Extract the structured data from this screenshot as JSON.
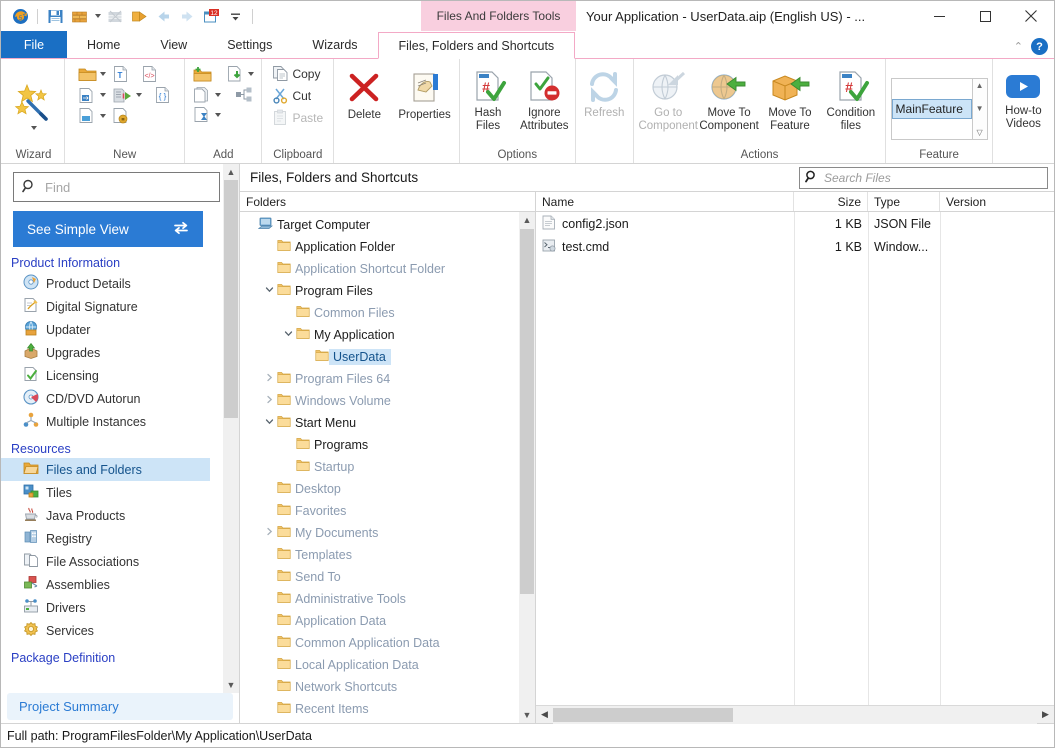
{
  "window": {
    "title": "Your Application - UserData.aip (English US) - ...",
    "contextual_tab_group": "Files And Folders Tools",
    "minimize": "─",
    "maximize": "☐",
    "close": "✕",
    "collapse_ribbon": "⌃",
    "help": "?"
  },
  "quick_access": {
    "items": [
      {
        "name": "app-icon"
      },
      {
        "name": "save-icon"
      },
      {
        "name": "build-icon"
      },
      {
        "name": "build-dropdown-caret"
      },
      {
        "name": "build-all-icon"
      },
      {
        "name": "run-icon"
      },
      {
        "name": "back-arrow-icon"
      },
      {
        "name": "forward-arrow-icon"
      },
      {
        "name": "trial-days-icon",
        "badge": "12"
      },
      {
        "name": "customize-qat-caret"
      }
    ]
  },
  "tabs": [
    {
      "label": "File",
      "id": "file",
      "active": false
    },
    {
      "label": "Home",
      "id": "home",
      "active": false
    },
    {
      "label": "View",
      "id": "view",
      "active": false
    },
    {
      "label": "Settings",
      "id": "settings",
      "active": false
    },
    {
      "label": "Wizards",
      "id": "wizards",
      "active": false
    },
    {
      "label": "Files, Folders and Shortcuts",
      "id": "files-folders-shortcuts",
      "active": true
    }
  ],
  "ribbon": {
    "groups": [
      {
        "label": "Wizard",
        "id": "wizard",
        "big": [
          {
            "label": "",
            "icon": "wizard-wand-icon",
            "disabled": false,
            "caret": true
          }
        ]
      },
      {
        "label": "New",
        "id": "new",
        "small": [
          {
            "label": "",
            "icon": "new-folder-icon",
            "caret": true
          },
          {
            "label": "",
            "icon": "new-text-file-icon",
            "caret": false
          },
          {
            "label": "",
            "icon": "new-xml-file-icon",
            "caret": false
          },
          {
            "label": "",
            "icon": "new-shortcut-icon",
            "caret": true
          },
          {
            "label": "",
            "icon": "new-import-icon",
            "caret": true
          },
          {
            "label": "",
            "icon": "new-json-file-icon",
            "caret": false
          },
          {
            "label": "",
            "icon": "new-ini-file-icon",
            "caret": true
          },
          {
            "label": "",
            "icon": "new-lock-file-icon",
            "caret": false
          }
        ]
      },
      {
        "label": "Add",
        "id": "add",
        "small": [
          {
            "label": "",
            "icon": "add-folder-icon",
            "caret": false
          },
          {
            "label": "",
            "icon": "add-file-icon",
            "caret": true
          },
          {
            "label": "",
            "icon": "add-files-icon",
            "caret": true
          },
          {
            "label": "",
            "icon": "add-temp-file-icon",
            "caret": true
          },
          {
            "label": "",
            "icon": "add-component-icon",
            "caret": false
          }
        ]
      },
      {
        "label": "Clipboard",
        "id": "clipboard",
        "small_labeled": [
          {
            "label": "Copy",
            "icon": "copy-icon",
            "disabled": false
          },
          {
            "label": "Cut",
            "icon": "cut-icon",
            "disabled": false
          },
          {
            "label": "Paste",
            "icon": "paste-icon",
            "disabled": true
          }
        ]
      },
      {
        "label": "",
        "id": "delete-properties",
        "big": [
          {
            "label": "Delete",
            "icon": "delete-x-icon",
            "disabled": false
          },
          {
            "label": "Properties",
            "icon": "properties-hand-icon",
            "disabled": false
          }
        ]
      },
      {
        "label": "Options",
        "id": "options",
        "big": [
          {
            "label": "Hash Files",
            "icon": "hash-files-icon",
            "disabled": false
          },
          {
            "label": "Ignore Attributes",
            "icon": "ignore-attributes-icon",
            "disabled": false
          }
        ]
      },
      {
        "label": "",
        "id": "refresh-group",
        "big": [
          {
            "label": "Refresh",
            "icon": "refresh-icon",
            "disabled": true
          }
        ]
      },
      {
        "label": "Actions",
        "id": "actions",
        "big": [
          {
            "label": "Go to Component",
            "icon": "go-to-component-icon",
            "disabled": true
          },
          {
            "label": "Move To Component",
            "icon": "move-to-component-icon",
            "disabled": false
          },
          {
            "label": "Move To Feature",
            "icon": "move-to-feature-icon",
            "disabled": false
          },
          {
            "label": "Condition files",
            "icon": "condition-files-icon",
            "disabled": false
          }
        ]
      },
      {
        "label": "Feature",
        "id": "feature",
        "gallery": {
          "selected": "MainFeature",
          "items": [
            "MainFeature"
          ]
        }
      },
      {
        "label": "",
        "id": "howto",
        "big": [
          {
            "label": "How-to Videos",
            "icon": "youtube-play-icon",
            "disabled": false
          }
        ]
      }
    ]
  },
  "sidebar": {
    "find": {
      "placeholder": "Find",
      "value": "",
      "icon": "search-icon"
    },
    "simple_view_button": {
      "label": "See Simple View",
      "icon": "swap-arrows-icon"
    },
    "sections": [
      {
        "title": "Product Information",
        "items": [
          {
            "label": "Product Details",
            "icon": "product-details-icon",
            "selected": false
          },
          {
            "label": "Digital Signature",
            "icon": "digital-signature-icon",
            "selected": false
          },
          {
            "label": "Updater",
            "icon": "updater-icon",
            "selected": false
          },
          {
            "label": "Upgrades",
            "icon": "upgrades-icon",
            "selected": false
          },
          {
            "label": "Licensing",
            "icon": "licensing-icon",
            "selected": false
          },
          {
            "label": "CD/DVD Autorun",
            "icon": "cd-dvd-autorun-icon",
            "selected": false
          },
          {
            "label": "Multiple Instances",
            "icon": "multiple-instances-icon",
            "selected": false
          }
        ]
      },
      {
        "title": "Resources",
        "items": [
          {
            "label": "Files and Folders",
            "icon": "files-and-folders-icon",
            "selected": true
          },
          {
            "label": "Tiles",
            "icon": "tiles-icon",
            "selected": false
          },
          {
            "label": "Java Products",
            "icon": "java-products-icon",
            "selected": false
          },
          {
            "label": "Registry",
            "icon": "registry-icon",
            "selected": false
          },
          {
            "label": "File Associations",
            "icon": "file-associations-icon",
            "selected": false
          },
          {
            "label": "Assemblies",
            "icon": "assemblies-icon",
            "selected": false
          },
          {
            "label": "Drivers",
            "icon": "drivers-icon",
            "selected": false
          },
          {
            "label": "Services",
            "icon": "services-icon",
            "selected": false
          }
        ]
      },
      {
        "title": "Package Definition",
        "items": []
      }
    ],
    "project_summary": "Project Summary"
  },
  "content": {
    "header_title": "Files, Folders and Shortcuts",
    "search": {
      "placeholder": "Search Files",
      "value": "",
      "icon": "search-icon"
    },
    "tree_column_header": "Folders",
    "tree": [
      {
        "label": "Target Computer",
        "depth": 0,
        "twist": "",
        "icon": "computer-icon",
        "dim": false,
        "selected": false
      },
      {
        "label": "Application Folder",
        "depth": 1,
        "twist": "",
        "icon": "folder-icon",
        "dim": false,
        "selected": false
      },
      {
        "label": "Application Shortcut Folder",
        "depth": 1,
        "twist": "",
        "icon": "folder-icon",
        "dim": true,
        "selected": false
      },
      {
        "label": "Program Files",
        "depth": 1,
        "twist": "expanded",
        "icon": "folder-icon",
        "dim": false,
        "selected": false
      },
      {
        "label": "Common Files",
        "depth": 2,
        "twist": "",
        "icon": "folder-icon",
        "dim": true,
        "selected": false
      },
      {
        "label": "My Application",
        "depth": 2,
        "twist": "expanded",
        "icon": "folder-icon",
        "dim": false,
        "selected": false
      },
      {
        "label": "UserData",
        "depth": 3,
        "twist": "",
        "icon": "folder-icon",
        "dim": false,
        "selected": true
      },
      {
        "label": "Program Files 64",
        "depth": 1,
        "twist": "collapsed",
        "icon": "folder-icon",
        "dim": true,
        "selected": false
      },
      {
        "label": "Windows Volume",
        "depth": 1,
        "twist": "collapsed",
        "icon": "folder-icon",
        "dim": true,
        "selected": false
      },
      {
        "label": "Start Menu",
        "depth": 1,
        "twist": "expanded",
        "icon": "folder-icon",
        "dim": false,
        "selected": false
      },
      {
        "label": "Programs",
        "depth": 2,
        "twist": "",
        "icon": "folder-icon",
        "dim": false,
        "selected": false
      },
      {
        "label": "Startup",
        "depth": 2,
        "twist": "",
        "icon": "folder-icon",
        "dim": true,
        "selected": false
      },
      {
        "label": "Desktop",
        "depth": 1,
        "twist": "",
        "icon": "folder-icon",
        "dim": true,
        "selected": false
      },
      {
        "label": "Favorites",
        "depth": 1,
        "twist": "",
        "icon": "folder-icon",
        "dim": true,
        "selected": false
      },
      {
        "label": "My Documents",
        "depth": 1,
        "twist": "collapsed",
        "icon": "folder-icon",
        "dim": true,
        "selected": false
      },
      {
        "label": "Templates",
        "depth": 1,
        "twist": "",
        "icon": "folder-icon",
        "dim": true,
        "selected": false
      },
      {
        "label": "Send To",
        "depth": 1,
        "twist": "",
        "icon": "folder-icon",
        "dim": true,
        "selected": false
      },
      {
        "label": "Administrative Tools",
        "depth": 1,
        "twist": "",
        "icon": "folder-icon",
        "dim": true,
        "selected": false
      },
      {
        "label": "Application Data",
        "depth": 1,
        "twist": "",
        "icon": "folder-icon",
        "dim": true,
        "selected": false
      },
      {
        "label": "Common Application Data",
        "depth": 1,
        "twist": "",
        "icon": "folder-icon",
        "dim": true,
        "selected": false
      },
      {
        "label": "Local Application Data",
        "depth": 1,
        "twist": "",
        "icon": "folder-icon",
        "dim": true,
        "selected": false
      },
      {
        "label": "Network Shortcuts",
        "depth": 1,
        "twist": "",
        "icon": "folder-icon",
        "dim": true,
        "selected": false
      },
      {
        "label": "Recent Items",
        "depth": 1,
        "twist": "",
        "icon": "folder-icon",
        "dim": true,
        "selected": false
      }
    ],
    "file_columns": [
      "Name",
      "Size",
      "Type",
      "Version"
    ],
    "files": [
      {
        "name": "config2.json",
        "size": "1 KB",
        "type": "JSON File",
        "version": "",
        "icon": "json-file-icon"
      },
      {
        "name": "test.cmd",
        "size": "1 KB",
        "type": "Window...",
        "version": "",
        "icon": "cmd-file-icon"
      }
    ]
  },
  "statusbar": {
    "text": "Full path: ProgramFilesFolder\\My Application\\UserData"
  },
  "colors": {
    "accent_blue": "#2b7bd4",
    "file_tab_blue": "#1a6fc4",
    "contextual_pink": "#f9cfdf",
    "contextual_border": "#f3a9c6",
    "selection_blue": "#cde4f7",
    "section_heading": "#2a3fc4",
    "dim_tree_text": "#8b9bb0"
  }
}
